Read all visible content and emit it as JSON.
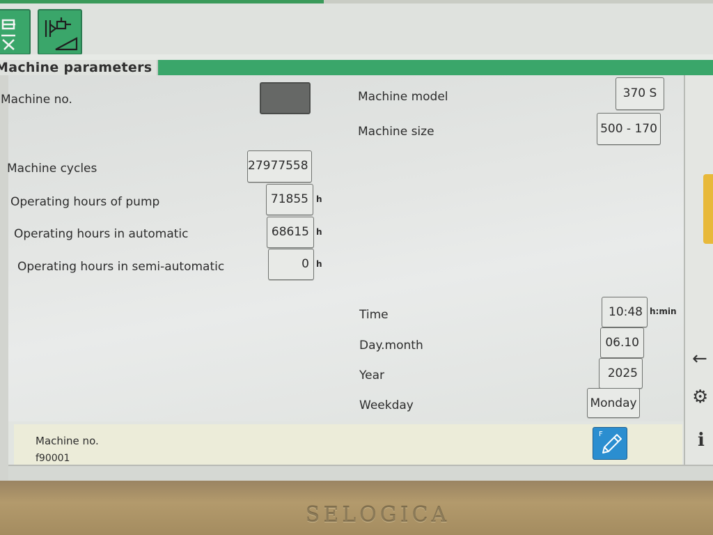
{
  "brand": "SELOGICA",
  "page": {
    "title": "Machine parameters"
  },
  "left": {
    "machine_no_label": "Machine no.",
    "cycles_label": "Machine cycles",
    "cycles_value": "27977558",
    "pump_label": "Operating hours of pump",
    "pump_value": "71855",
    "auto_label": "Operating hours in automatic",
    "auto_value": "68615",
    "semi_label": "Operating hours in semi-automatic",
    "semi_value": "0",
    "hours_unit": "h"
  },
  "right": {
    "model_label": "Machine model",
    "model_value": "370 S",
    "size_label": "Machine size",
    "size_value": "500 - 170",
    "time_label": "Time",
    "time_value": "10:48",
    "time_unit": "h:min",
    "daymonth_label": "Day.month",
    "daymonth_value": "06.10",
    "year_label": "Year",
    "year_value": "2025",
    "weekday_label": "Weekday",
    "weekday_value": "Monday"
  },
  "footer": {
    "field_name": "Machine no.",
    "field_value": "f90001",
    "edit_key": "F"
  },
  "icons": [
    "machine-nav-icon",
    "machine-parameters-icon",
    "back-arrow-icon",
    "settings-gear-icon",
    "info-icon",
    "pencil-icon"
  ],
  "colors": {
    "accent_green": "#3aa66a",
    "edit_blue": "#2b8ed0",
    "side_tab_yellow": "#e8b93a"
  }
}
